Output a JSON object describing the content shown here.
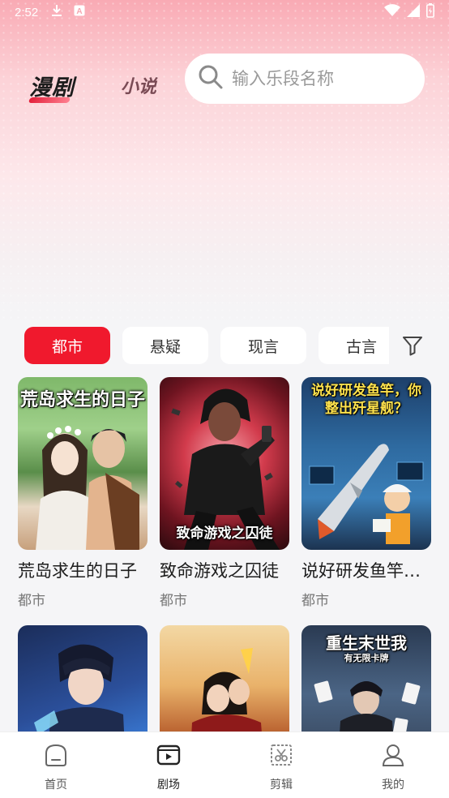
{
  "status_bar": {
    "time": "2:52",
    "icons": [
      "download-icon",
      "a-badge-icon",
      "wifi-icon",
      "signal-icon",
      "battery-icon"
    ]
  },
  "top_tabs": [
    {
      "label": "漫剧",
      "active": true
    },
    {
      "label": "小说",
      "active": false
    }
  ],
  "search": {
    "placeholder": "输入乐段名称",
    "value": ""
  },
  "categories": [
    {
      "label": "都市",
      "active": true
    },
    {
      "label": "悬疑",
      "active": false
    },
    {
      "label": "现言",
      "active": false
    },
    {
      "label": "古言",
      "active": false
    }
  ],
  "filter_icon": "filter-icon",
  "cards": [
    {
      "title": "荒岛求生的日子",
      "tag": "都市",
      "cover_text": "荒岛求生的日子"
    },
    {
      "title": "致命游戏之囚徒",
      "tag": "都市",
      "cover_text": "致命游戏之囚徒"
    },
    {
      "title": "说好研发鱼竿，你整出歼星舰？",
      "tag": "都市",
      "cover_text": "说好研发鱼竿，你整出歼星舰？"
    },
    {
      "title": "",
      "tag": "",
      "cover_text": ""
    },
    {
      "title": "",
      "tag": "",
      "cover_text": ""
    },
    {
      "title": "",
      "tag": "",
      "cover_text": "重生末世我"
    },
    {
      "cover_subtext": "有无限卡牌"
    }
  ],
  "bottom_nav": [
    {
      "label": "首页",
      "icon": "home-icon",
      "active": false
    },
    {
      "label": "剧场",
      "icon": "theater-icon",
      "active": true
    },
    {
      "label": "剪辑",
      "icon": "edit-icon",
      "active": false
    },
    {
      "label": "我的",
      "icon": "profile-icon",
      "active": false
    }
  ],
  "colors": {
    "accent": "#f0192d",
    "header_gradient_top": "#f9aab4"
  }
}
